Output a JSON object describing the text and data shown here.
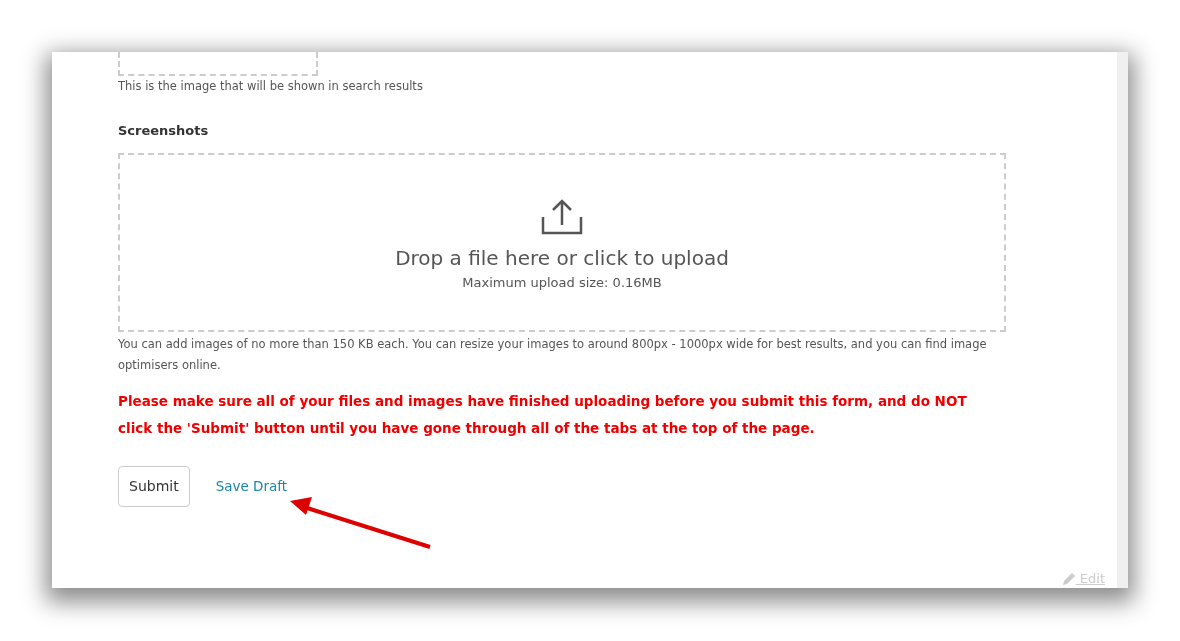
{
  "featured_image": {
    "hint": "This is the image that will be shown in search results"
  },
  "screenshots": {
    "label": "Screenshots",
    "dropzone_title": "Drop a file here or click to upload",
    "dropzone_limit": "Maximum upload size: 0.16MB",
    "hint": "You can add images of no more than 150 KB each. You can resize your images to around 800px - 1000px wide for best results, and you can find image optimisers online."
  },
  "warning": "Please make sure all of your files and images have finished uploading before you submit this form, and do NOT click the 'Submit' button until you have gone through all of the tabs at the top of the page.",
  "buttons": [
    {
      "kind": "button",
      "label": "Submit"
    },
    {
      "kind": "link",
      "label": "Save Draft"
    }
  ],
  "edit_link": "Edit"
}
